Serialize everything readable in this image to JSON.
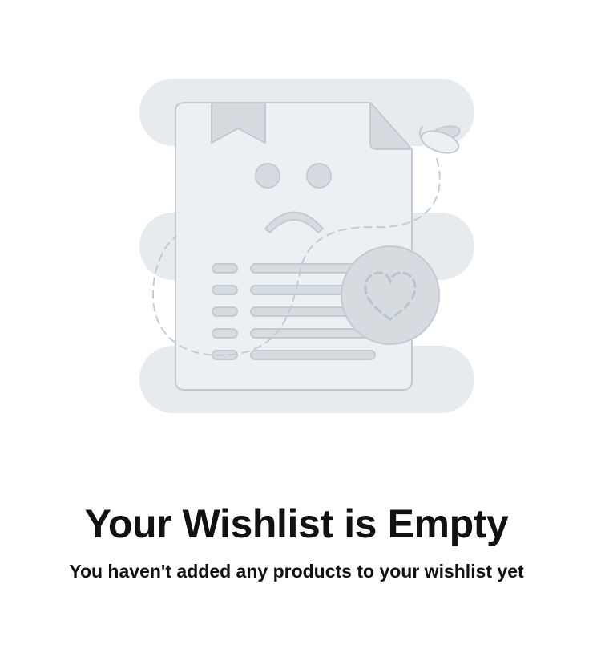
{
  "empty_state": {
    "title": "Your Wishlist is Empty",
    "message": "You haven't added any products to your wishlist yet"
  },
  "illustration": {
    "icon": "sad-document-wishlist-illustration",
    "colors": {
      "background_blob": "#e8ebee",
      "paper": "#edf0f2",
      "outline": "#c2cbd3",
      "accent_fill": "#d6dbdf",
      "dashed_path": "#c2cbd3"
    }
  }
}
